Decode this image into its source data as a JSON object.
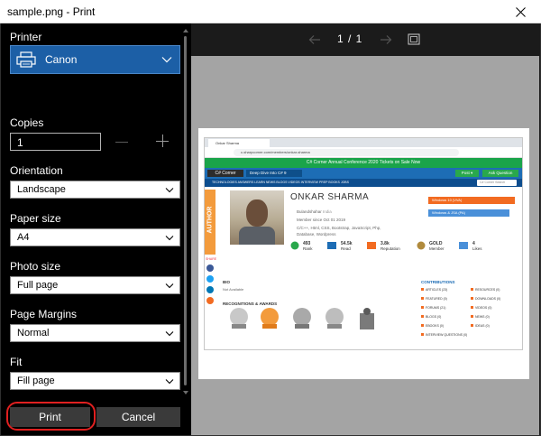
{
  "window": {
    "title": "sample.png - Print"
  },
  "settings": {
    "printer_label": "Printer",
    "printer_value": "Canon",
    "copies_label": "Copies",
    "copies_value": "1",
    "orientation_label": "Orientation",
    "orientation_value": "Landscape",
    "paper_size_label": "Paper size",
    "paper_size_value": "A4",
    "photo_size_label": "Photo size",
    "photo_size_value": "Full page",
    "margins_label": "Page Margins",
    "margins_value": "Normal",
    "fit_label": "Fit",
    "fit_value": "Fill page",
    "print_button": "Print",
    "cancel_button": "Cancel"
  },
  "preview": {
    "page_indicator": "1 / 1",
    "screenshot": {
      "tab_title": "Onkar Sharma",
      "url": "c-sharpcorner.com/members/onkar-sharma",
      "banner": "C# Corner Annual Conference 2020 Tickets on Sale Now",
      "logo": "C# Corner",
      "deep_dive": "Deep Dive Into C# 9",
      "post": "Post ▾",
      "ask": "Ask Question",
      "menu": "TECHNOLOGIES   ANSWERS   LEARN   NEWS   BLOGS   VIDEOS   INTERVIEW PREP   BOOKS   JOBS",
      "search_placeholder": "C# Corner Search",
      "author_tab": "AUTHOR",
      "share": "SHARE",
      "name": "ONKAR SHARMA",
      "location_city": "Bulandshahar",
      "location_country": "India",
      "member_since": "Member since Oct 01 2019",
      "skills": "C/C++, Html, CSS, Bootstrap, JavaScript, Php,",
      "skills2": "Database, Wordpress",
      "tag1": "Windows 10 (VVA)",
      "tag2": "Windows & JSA (PA)",
      "stats": [
        {
          "value": "493",
          "label": "Rank"
        },
        {
          "value": "54.5k",
          "label": "Read"
        },
        {
          "value": "3.8k",
          "label": "Reputation"
        },
        {
          "value": "GOLD",
          "label": "Member"
        },
        {
          "value": "4",
          "label": "Likes"
        }
      ],
      "bio_heading": "BIO",
      "bio_text": "Not Available",
      "recognitions_heading": "RECOGNITIONS & AWARDS",
      "contributions_heading": "CONTRIBUTIONS",
      "contributions": [
        "ARTICLES (23)",
        "RESOURCES (0)",
        "FEATURED (0)",
        "DOWNLOADS (0)",
        "FORUMS (21)",
        "VIDEOS (0)",
        "BLOGS (0)",
        "NEWS (0)",
        "EBOOKS (0)",
        "IDEAS (0)",
        "INTERVIEW QUESTIONS (0)"
      ]
    }
  },
  "colors": {
    "printer_select_bg": "#1c5fa6",
    "highlight_ring": "#e02020",
    "banner_green": "#1aa44a",
    "header_blue": "#1d6db5",
    "author_orange": "#f39b3c"
  }
}
